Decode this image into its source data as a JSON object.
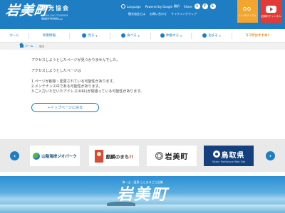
{
  "header": {
    "logo_brush": "岩美町",
    "logo_assoc": "観光協会",
    "logo_sub": "IWAMI-CHO TOURISM ASSOCIATION",
    "logo_sub2": "Tottori Prefecture",
    "language_label": "Language",
    "powered_label": "Powered by",
    "google_label": "Google",
    "translate_label": "翻訳",
    "share_label": "Share",
    "util_links": [
      "観光協会とは",
      "お問い合わせ",
      "サイクリングマップ"
    ],
    "cycle_btn_label": "レンタサイクル",
    "tube_btn_label": "岩美町チャンネル"
  },
  "nav": {
    "items": [
      {
        "label": "ホーム",
        "highlight": false
      },
      {
        "label": "新着情報",
        "highlight": false
      },
      {
        "label": "見る",
        "highlight": false
      },
      {
        "label": "食べる",
        "highlight": false
      },
      {
        "label": "体験する",
        "highlight": false
      },
      {
        "label": "泊まる",
        "highlight": false
      },
      {
        "label": "ココがおすすめ！",
        "highlight": true
      }
    ]
  },
  "breadcrumb": {
    "home": "ホーム",
    "current": "404"
  },
  "main": {
    "line1": "アクセスしようとしたページが見つかりませんでした。",
    "line2": "アクセスしようとしたページは",
    "line3": "1.ページが削除・変更されている可能性があります。",
    "line4": "2.メンテナンス中である可能性があります。",
    "line5": "3.ご入力いただいたアドレス(URL)が間違っている可能性があります。",
    "back_button": "←トップページに戻る"
  },
  "banners": {
    "items": [
      {
        "label": "山陰海岸ジオパーク"
      },
      {
        "label": "麒麟のまち",
        "mark": "!!"
      },
      {
        "label": "岩美町"
      },
      {
        "label": "鳥取県",
        "sub": "Tottori Prefecture Web Site"
      }
    ]
  },
  "hero": {
    "tagline": "海・山・温泉 ここまるごと岩美",
    "logo": "岩美町"
  }
}
